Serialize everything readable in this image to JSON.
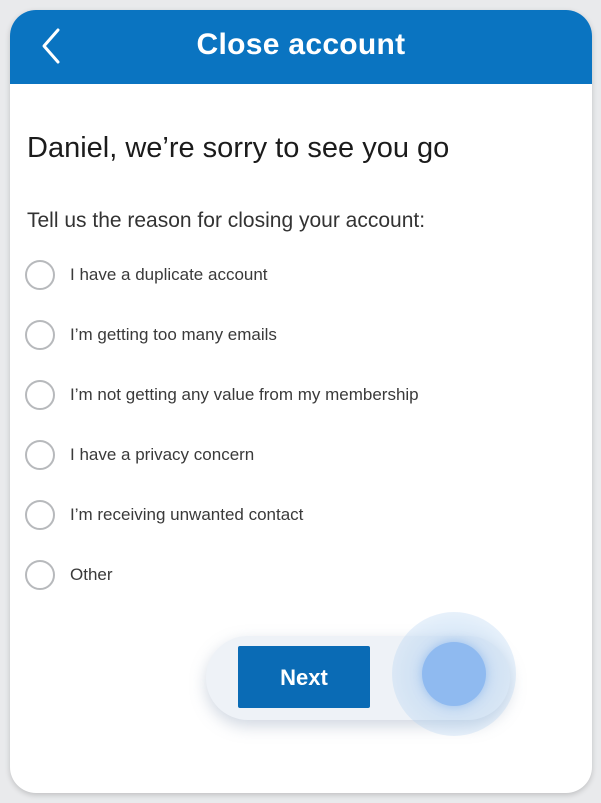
{
  "header": {
    "title": "Close account",
    "back_icon": "chevron-left-icon",
    "background_color": "#0a74c1"
  },
  "main": {
    "headline": "Daniel, we’re sorry to see you go",
    "prompt": "Tell us the reason for closing your account:",
    "options": [
      {
        "label": "I have a duplicate account",
        "selected": false
      },
      {
        "label": "I’m getting too many emails",
        "selected": false
      },
      {
        "label": "I’m not getting any value from my membership",
        "selected": false
      },
      {
        "label": "I have a privacy concern",
        "selected": false
      },
      {
        "label": "I’m receiving unwanted contact",
        "selected": false
      },
      {
        "label": "Other",
        "selected": false
      }
    ]
  },
  "footer": {
    "next_label": "Next",
    "accent_color": "#0a6bb5"
  }
}
